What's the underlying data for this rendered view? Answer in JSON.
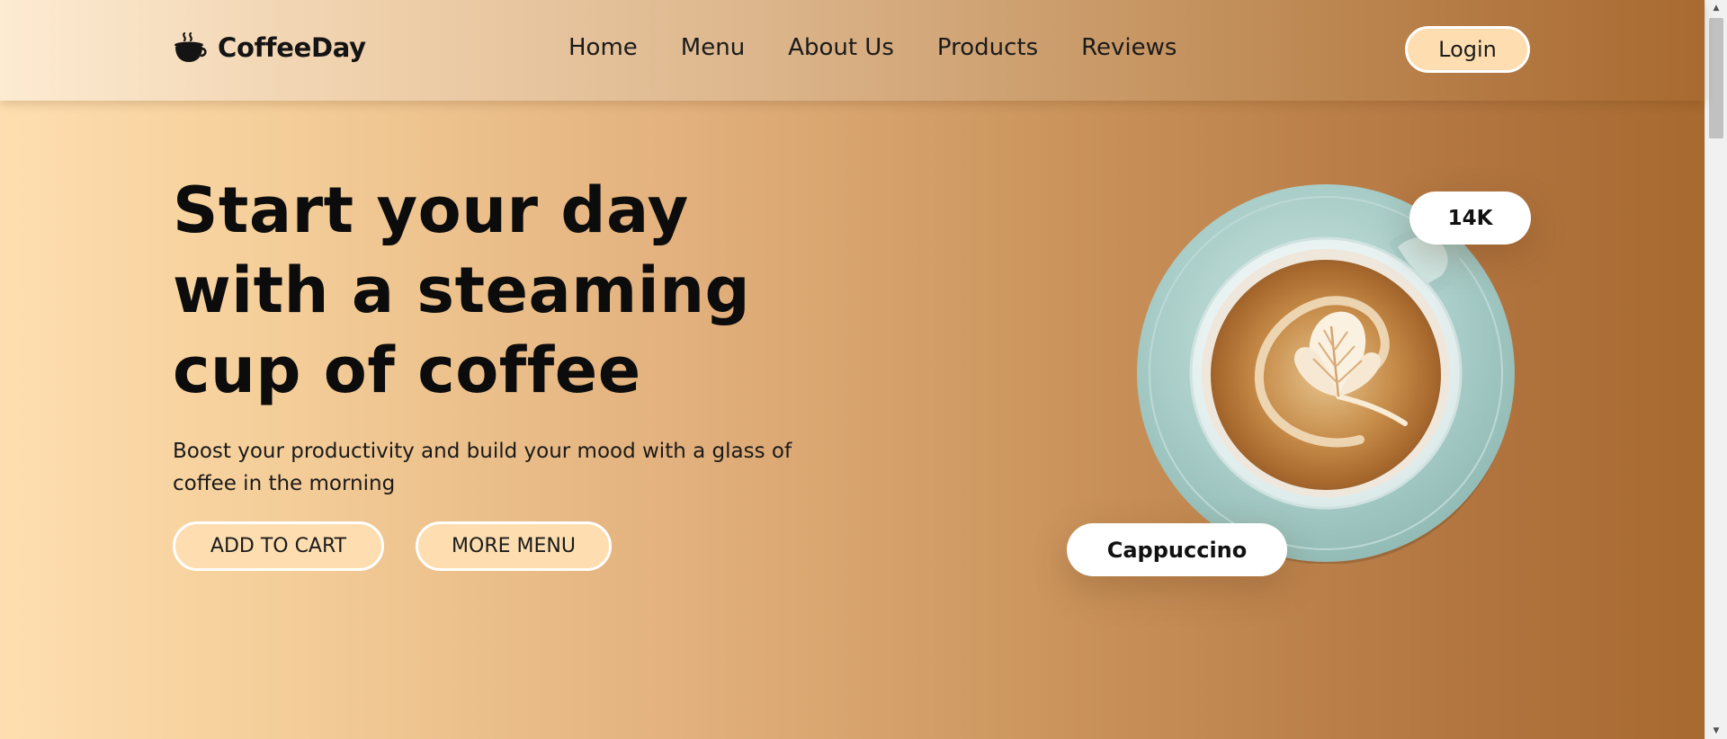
{
  "header": {
    "brand": "CoffeeDay",
    "logo_icon": "coffee-cup-icon",
    "nav": [
      {
        "label": "Home"
      },
      {
        "label": "Menu"
      },
      {
        "label": "About Us"
      },
      {
        "label": "Products"
      },
      {
        "label": "Reviews"
      }
    ],
    "login_label": "Login"
  },
  "hero": {
    "title": "Start your day with a steaming cup of coffee",
    "subtitle": "Boost your productivity and build your mood with a glass of coffee in the morning",
    "add_to_cart_label": "ADD TO CART",
    "more_menu_label": "MORE MENU"
  },
  "product": {
    "count_badge": "14K",
    "name_badge": "Cappuccino",
    "image_icon": "cappuccino-cup-image"
  },
  "colors": {
    "accent": "#fedeb0",
    "dark_brown": "#a6682d",
    "text": "#141414"
  }
}
